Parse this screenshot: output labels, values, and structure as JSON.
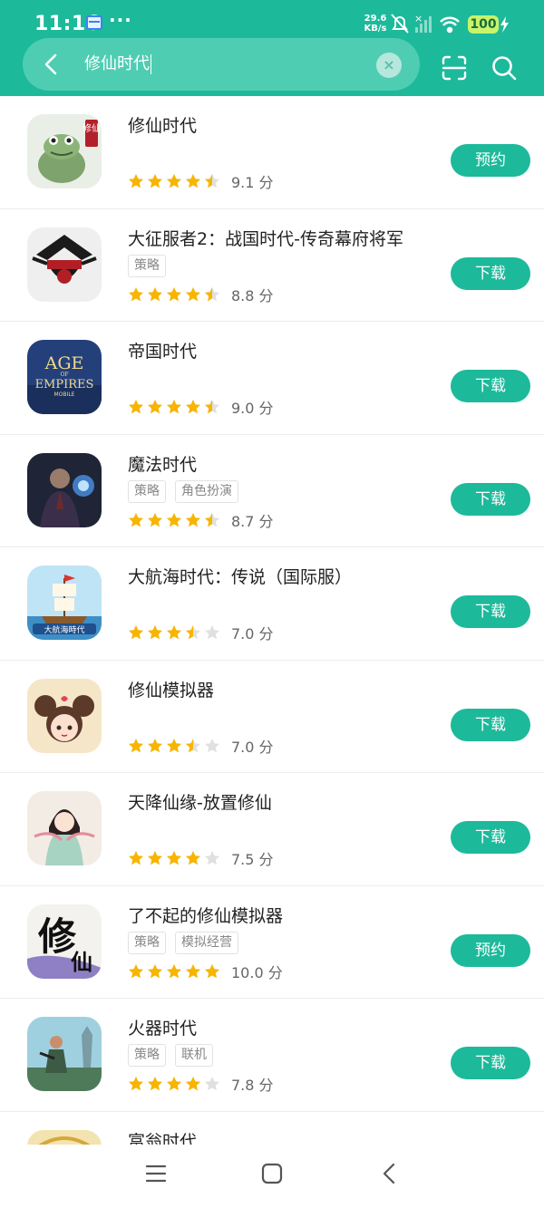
{
  "status_bar": {
    "time": "11:16",
    "dots": "···",
    "net_speed_value": "29.6",
    "net_speed_unit": "KB/s",
    "battery": "100"
  },
  "search": {
    "query": "修仙时代",
    "clear_glyph": "×"
  },
  "colors": {
    "primary": "#1db99b",
    "star": "#f7b500",
    "star_empty": "#e0e0e0"
  },
  "results": [
    {
      "name": "修仙时代",
      "tags": [],
      "rating": 4.5,
      "score": "9.1 分",
      "action": "预约",
      "icon": "toad-icon"
    },
    {
      "name": "大征服者2：战国时代-传奇幕府将军",
      "tags": [
        "策略"
      ],
      "rating": 4.5,
      "score": "8.8 分",
      "action": "下载",
      "icon": "samurai-helmet-icon"
    },
    {
      "name": "帝国时代",
      "tags": [],
      "rating": 4.5,
      "score": "9.0 分",
      "action": "下载",
      "icon": "age-of-empires-icon"
    },
    {
      "name": "魔法时代",
      "tags": [
        "策略",
        "角色扮演"
      ],
      "rating": 4.5,
      "score": "8.7 分",
      "action": "下载",
      "icon": "sorcerer-icon"
    },
    {
      "name": "大航海时代：传说（国际服）",
      "tags": [],
      "rating": 3.5,
      "score": "7.0 分",
      "action": "下载",
      "icon": "sailing-ship-icon"
    },
    {
      "name": "修仙模拟器",
      "tags": [],
      "rating": 3.5,
      "score": "7.0 分",
      "action": "下载",
      "icon": "anime-girl-icon"
    },
    {
      "name": "天降仙缘-放置修仙",
      "tags": [],
      "rating": 4,
      "score": "7.5 分",
      "action": "下载",
      "icon": "fairy-lady-icon"
    },
    {
      "name": "了不起的修仙模拟器",
      "tags": [
        "策略",
        "模拟经营"
      ],
      "rating": 5,
      "score": "10.0 分",
      "action": "预约",
      "icon": "calligraphy-icon"
    },
    {
      "name": "火器时代",
      "tags": [
        "策略",
        "联机"
      ],
      "rating": 4,
      "score": "7.8 分",
      "action": "下载",
      "icon": "gunner-icon"
    },
    {
      "name": "富翁时代",
      "tags": [],
      "rating": 0,
      "score": "",
      "action": "",
      "icon": "tycoon-icon"
    }
  ],
  "icon_labels": {
    "toad": "修仙",
    "age1": "AGE",
    "age2": "OF",
    "age3": "EMPIRES",
    "age4": "MOBILE",
    "ship": "大航海時代",
    "calligraphy1": "修",
    "calligraphy2": "仙"
  }
}
